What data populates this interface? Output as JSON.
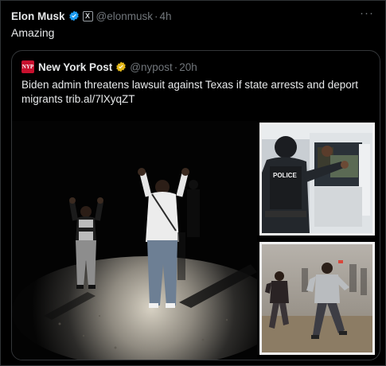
{
  "post": {
    "author": "Elon Musk",
    "handle": "@elonmusk",
    "separator": "·",
    "time": "4h",
    "text": "Amazing",
    "more": "···",
    "affiliate_label": "X"
  },
  "quote": {
    "author": "New York Post",
    "logo_text": "NYP",
    "handle": "@nypost",
    "separator": "·",
    "time": "20h",
    "text": "Biden admin threatens lawsuit against Texas if state arrests and deport migrants trib.al/7lXyqZT"
  },
  "media": {
    "main_photo": "two-men-hands-raised-night",
    "side_photo_top": "police-officer-at-vehicle",
    "side_photo_bottom": "migrants-running"
  },
  "badge_text": {
    "police": "POLICE"
  },
  "colors": {
    "background": "#000000",
    "text": "#e7e9ea",
    "secondary": "#71767b",
    "verified_blue": "#1d9bf0",
    "verified_gold": "#e2b719",
    "nyp_red": "#c8102e"
  }
}
